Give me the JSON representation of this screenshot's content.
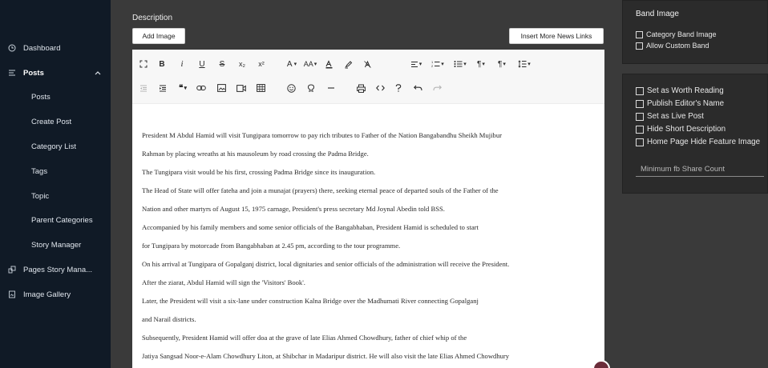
{
  "sidebar": {
    "items": [
      {
        "label": "Dashboard",
        "icon": "clock-icon"
      },
      {
        "label": "Posts",
        "icon": "posts-list-icon"
      },
      {
        "label": "Posts"
      },
      {
        "label": "Create Post"
      },
      {
        "label": "Category List"
      },
      {
        "label": "Tags"
      },
      {
        "label": "Topic"
      },
      {
        "label": "Parent Categories"
      },
      {
        "label": "Story Manager"
      },
      {
        "label": "Pages Story Mana...",
        "icon": "pages-story-icon"
      },
      {
        "label": "Image Gallery",
        "icon": "image-gallery-icon"
      }
    ]
  },
  "editor": {
    "description_label": "Description",
    "add_image_label": "Add Image",
    "insert_links_label": "Insert More News Links",
    "toolbar": {
      "bold": "B",
      "italic": "i",
      "underline": "U",
      "strikethrough": "S",
      "subscript": "x₂",
      "superscript": "x²",
      "font_size": "A",
      "font_case": "AA"
    },
    "content": [
      "President M Abdul Hamid will visit Tungipara tomorrow to pay rich tributes to Father of the Nation Bangabandhu Sheikh Mujibur",
      "Rahman by placing wreaths at his mausoleum by road crossing the Padma Bridge.",
      "The Tungipara visit would be his first, crossing Padma Bridge since its inauguration.",
      "The Head of State will offer fateha and join a munajat (prayers) there, seeking eternal peace of departed souls of the Father of the",
      "Nation and other martyrs of August 15, 1975 carnage, President's press secretary Md Joynal Abedin told BSS.",
      "Accompanied by his family members and some senior officials of the Bangabhaban, President Hamid is scheduled to start",
      "for Tungipara by motorcade from Bangabhaban at 2.45 pm, according to the tour programme.",
      "On his arrival at Tungipara of Gopalganj district, local dignitaries and senior officials of the administration will receive the President.",
      "After the ziarat, Abdul Hamid will sign the 'Visitors' Book'.",
      "Later, the President will visit a six-lane under construction Kalna Bridge over the Madhumati River connecting Gopalganj",
      "and Narail districts.",
      "Subsequently, President Hamid will offer doa at the grave of late Elias Ahmed Chowdhury, father of chief whip of the",
      "Jatiya Sangsad Noor-e-Alam Chowdhury Liton, at Shibchar in Madaripur district. He will also visit the late Elias Ahmed Chowdhury"
    ]
  },
  "right_panel": {
    "band_title": "Band Image",
    "band_options": [
      "Category Band Image",
      "Allow Custom Band"
    ],
    "options": [
      "Set as Worth Reading",
      "Publish Editor's Name",
      "Set as Live Post",
      "Hide Short Description",
      "Home Page Hide Feature Image"
    ],
    "share_placeholder": "Minimum fb Share Count"
  }
}
